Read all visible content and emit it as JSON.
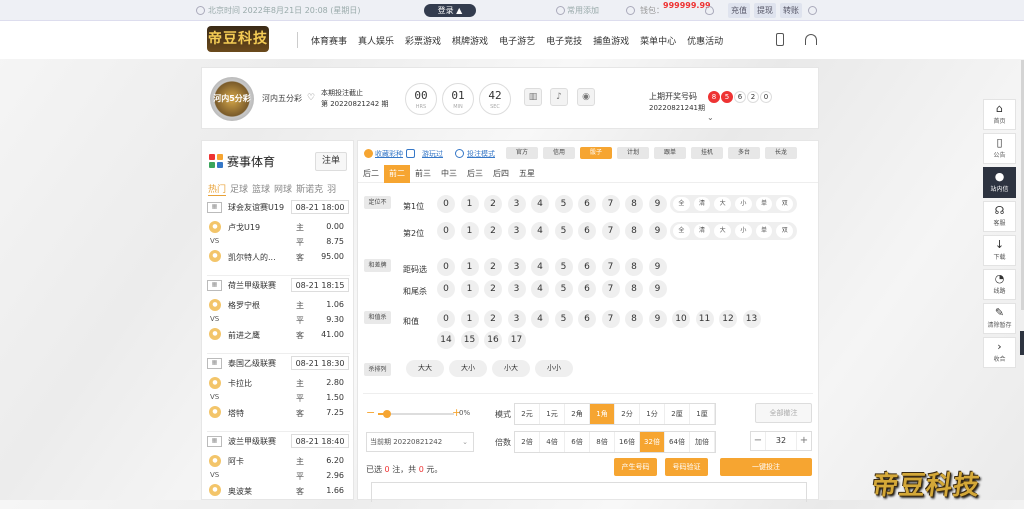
{
  "topbar": {
    "time": "北京时间 2022年8月21日 20:08 (星期日)",
    "login": "登录",
    "favorite": "常用添加",
    "balance_label": "钱包：",
    "balance": "999999.99",
    "buttons": [
      "充值",
      "提现",
      "转账"
    ]
  },
  "nav": {
    "logo": "帝豆科技",
    "menu": [
      "体育赛事",
      "真人娱乐",
      "彩票游戏",
      "棋牌游戏",
      "电子游艺",
      "电子竞技",
      "捕鱼游戏",
      "菜单中心",
      "优惠活动"
    ]
  },
  "game": {
    "badge": "河内5分彩",
    "name": "河内五分彩",
    "cutoff_label": "本期投注截止",
    "cutoff_issue": "第 20220821242 期",
    "countdown": [
      {
        "value": "00",
        "unit": "HRS"
      },
      {
        "value": "01",
        "unit": "MIN"
      },
      {
        "value": "42",
        "unit": "SEC"
      }
    ],
    "last_label": "上期开奖号码",
    "last_issue": "20220821241期",
    "last_numbers": [
      "8",
      "5",
      "6",
      "2",
      "0"
    ],
    "last_numbers_red": 2
  },
  "sports": {
    "title": "赛事体育",
    "register": "注单",
    "tabs": [
      "热门",
      "足球",
      "篮球",
      "网球",
      "斯诺克",
      "羽"
    ],
    "matches": [
      {
        "league": "球会友谊赛U19",
        "date": "08-21 18:00",
        "home": "卢戈U19",
        "away": "凯尔特人的...",
        "odds": [
          {
            "l": "主",
            "v": "0.00"
          },
          {
            "l": "平",
            "v": "8.75"
          },
          {
            "l": "客",
            "v": "95.00"
          }
        ]
      },
      {
        "league": "荷兰甲级联赛",
        "date": "08-21 18:15",
        "home": "格罗宁根",
        "away": "前进之鹰",
        "odds": [
          {
            "l": "主",
            "v": "1.06"
          },
          {
            "l": "平",
            "v": "9.30"
          },
          {
            "l": "客",
            "v": "41.00"
          }
        ]
      },
      {
        "league": "泰国乙级联赛",
        "date": "08-21 18:30",
        "home": "卡拉比",
        "away": "塔特",
        "odds": [
          {
            "l": "主",
            "v": "2.80"
          },
          {
            "l": "平",
            "v": "1.50"
          },
          {
            "l": "客",
            "v": "7.25"
          }
        ]
      },
      {
        "league": "波兰甲级联赛",
        "date": "08-21 18:40",
        "home": "阿卡",
        "away": "奥波莱",
        "odds": [
          {
            "l": "主",
            "v": "6.20"
          },
          {
            "l": "平",
            "v": "2.96"
          },
          {
            "l": "客",
            "v": "1.66"
          }
        ]
      }
    ]
  },
  "bet": {
    "links": [
      "收藏彩种",
      "游玩过",
      "投注模式"
    ],
    "modes": [
      "官方",
      "信用",
      "骰子",
      "计划",
      "跟单",
      "挂机",
      "多台",
      "长龙"
    ],
    "mode_active": 2,
    "tabs": [
      "后二",
      "前二",
      "前三",
      "中三",
      "后三",
      "后四",
      "五星"
    ],
    "tab_active": 1,
    "rows": [
      {
        "group": "定位不",
        "name": "第1位",
        "nums": [
          "0",
          "1",
          "2",
          "3",
          "4",
          "5",
          "6",
          "7",
          "8",
          "9"
        ]
      },
      {
        "group": "",
        "name": "第2位",
        "nums": [
          "0",
          "1",
          "2",
          "3",
          "4",
          "5",
          "6",
          "7",
          "8",
          "9"
        ]
      },
      {
        "group": "和差牌",
        "name": "距码选",
        "nums": [
          "0",
          "1",
          "2",
          "3",
          "4",
          "5",
          "6",
          "7",
          "8",
          "9"
        ]
      },
      {
        "group": "",
        "name": "和尾杀",
        "nums": [
          "0",
          "1",
          "2",
          "3",
          "4",
          "5",
          "6",
          "7",
          "8",
          "9"
        ]
      },
      {
        "group": "和值杀",
        "name": "和值",
        "nums": [
          "0",
          "1",
          "2",
          "3",
          "4",
          "5",
          "6",
          "7",
          "8",
          "9",
          "10",
          "11",
          "12",
          "13",
          "14",
          "15",
          "16",
          "17"
        ]
      }
    ],
    "quick": [
      "全",
      "清",
      "大",
      "小",
      "单",
      "双"
    ],
    "pill_group": "杀排列",
    "pills": [
      "大大",
      "大小",
      "小大",
      "小小"
    ],
    "slider_value": "0%",
    "mode_label": "模式",
    "modes_unit": [
      "2元",
      "1元",
      "2角",
      "1角",
      "2分",
      "1分",
      "2厘",
      "1厘"
    ],
    "unit_active": 3,
    "multiple_label": "倍数",
    "multiples": [
      "2倍",
      "4倍",
      "6倍",
      "8倍",
      "16倍",
      "32倍",
      "64倍",
      "加倍"
    ],
    "multiple_active": 5,
    "cancel_all": "全部撤注",
    "issue": "当前期 20220821242",
    "qty": "32",
    "summary_a": "已选",
    "summary_b": "注，共",
    "summary_c": "元。",
    "summary_count": "0",
    "summary_total": "0",
    "buttons": [
      "产生号码",
      "号码验证",
      "一键投注"
    ],
    "watermark": "帝豆科技"
  },
  "rail": [
    {
      "label": "首页",
      "icon": "⌂"
    },
    {
      "label": "公告",
      "icon": "▯"
    },
    {
      "label": "站内信",
      "icon": "●"
    },
    {
      "label": "客服",
      "icon": "☊"
    },
    {
      "label": "下载",
      "icon": "↓"
    },
    {
      "label": "线路",
      "icon": "◔"
    },
    {
      "label": "清除暂存",
      "icon": "✎"
    },
    {
      "label": "收合",
      "icon": "›"
    }
  ]
}
